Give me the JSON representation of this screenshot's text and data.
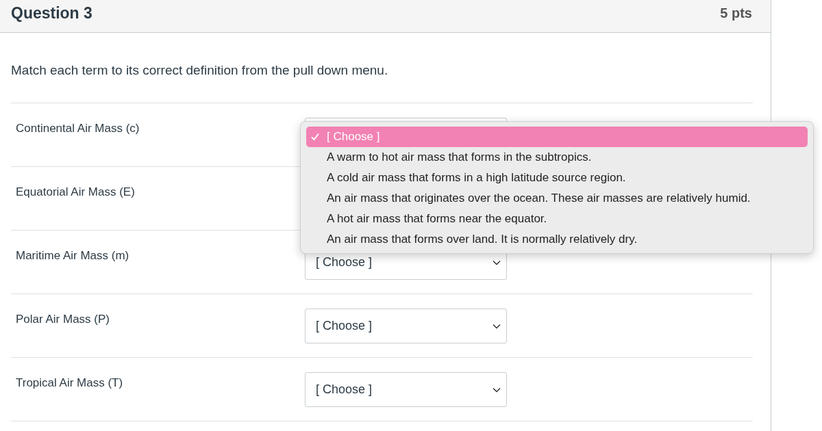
{
  "question": {
    "title": "Question 3",
    "points": "5 pts"
  },
  "prompt": "Match each term to its correct definition from the pull down menu.",
  "rows": [
    {
      "term": "Continental Air Mass (c)",
      "dropdown": true
    },
    {
      "term": "Equatorial Air Mass (E)"
    },
    {
      "term": "Maritime Air Mass (m)",
      "dropdown": true,
      "choice": "[ Choose ]"
    },
    {
      "term": "Polar Air Mass (P)",
      "dropdown": true,
      "choice": "[ Choose ]"
    },
    {
      "term": "Tropical Air Mass (T)",
      "dropdown": true,
      "choice": "[ Choose ]"
    }
  ],
  "menu": {
    "options": [
      {
        "label": "[ Choose ]",
        "selected": true
      },
      {
        "label": "A warm to hot air mass that forms in the subtropics.",
        "selected": false
      },
      {
        "label": "A cold air mass that forms in a high latitude source region.",
        "selected": false
      },
      {
        "label": "An air mass that originates over the ocean. These air masses are relatively humid.",
        "selected": false
      },
      {
        "label": "A hot air mass that forms near the equator.",
        "selected": false
      },
      {
        "label": "An air mass that forms over land. It is normally relatively dry.",
        "selected": false
      }
    ]
  }
}
